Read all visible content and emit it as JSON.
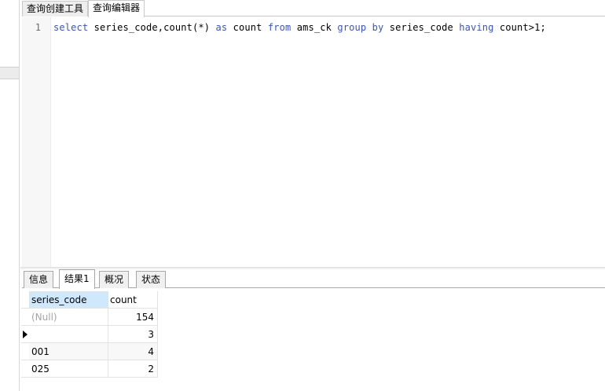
{
  "top_tabs": [
    {
      "label": "查询创建工具",
      "active": false
    },
    {
      "label": "查询编辑器",
      "active": true
    }
  ],
  "editor": {
    "line_number": "1",
    "sql": {
      "t1": "select",
      "t2": " series_code,count(*) ",
      "t3": "as",
      "t4": " count ",
      "t5": "from",
      "t6": " ams_ck ",
      "t7": "group by",
      "t8": " series_code ",
      "t9": "having",
      "t10": " count>",
      "t11": "1",
      "t12": ";"
    }
  },
  "bottom_tabs": [
    {
      "label": "信息",
      "active": false
    },
    {
      "label": "结果1",
      "active": true
    },
    {
      "label": "概况",
      "active": false
    },
    {
      "label": "状态",
      "active": false
    }
  ],
  "grid": {
    "columns": [
      "series_code",
      "count"
    ],
    "rows": [
      {
        "series_code": "(Null)",
        "count": "154"
      },
      {
        "series_code": "",
        "count": "3"
      },
      {
        "series_code": "001",
        "count": "4"
      },
      {
        "series_code": "025",
        "count": "2"
      }
    ]
  },
  "colors": {
    "keyword": "#3b53c9",
    "header_highlight": "#cfe8fb",
    "null_text": "#a4a4a4"
  }
}
